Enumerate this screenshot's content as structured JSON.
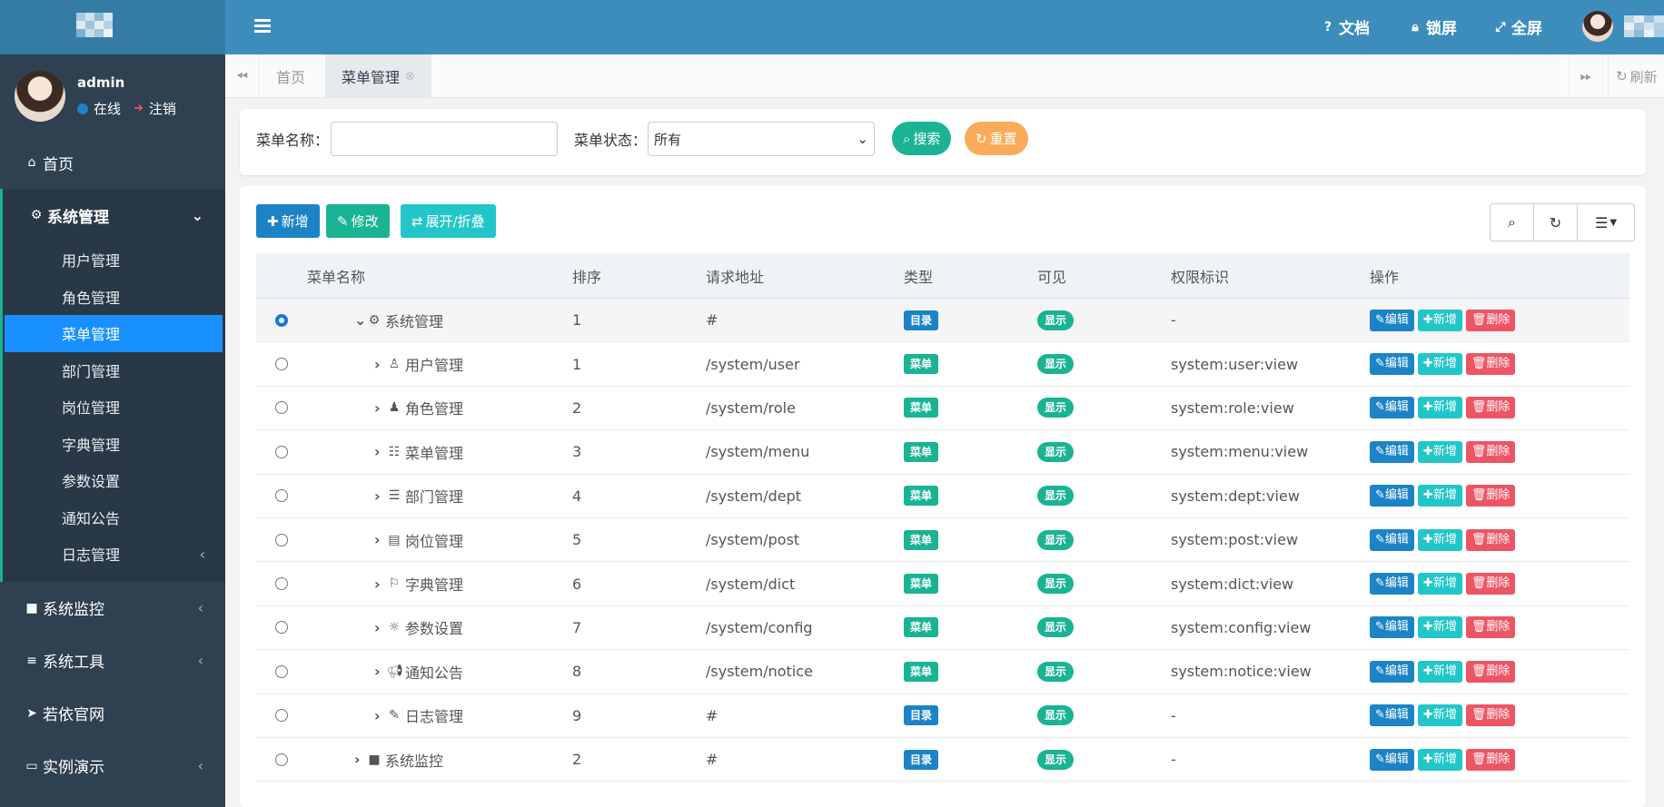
{
  "colors": {
    "sidebar": "#2f4050",
    "topbar": "#3c8dbc",
    "active": "#1890ff",
    "primary": "#1c84c6",
    "info": "#23c6c8",
    "success": "#1ab394",
    "warning": "#f8ac59",
    "danger": "#ed5565"
  },
  "user": {
    "name": "admin",
    "status": "在线",
    "logout": "注销"
  },
  "nav": {
    "home": "首页",
    "system": "系统管理",
    "system_items": [
      "用户管理",
      "角色管理",
      "菜单管理",
      "部门管理",
      "岗位管理",
      "字典管理",
      "参数设置",
      "通知公告",
      "日志管理"
    ],
    "monitor": "系统监控",
    "tools": "系统工具",
    "site": "若依官网",
    "demo": "实例演示"
  },
  "topbar": {
    "docs": "文档",
    "lock": "锁屏",
    "fullscreen": "全屏"
  },
  "tabs": {
    "home": "首页",
    "menu": "菜单管理",
    "refresh": "刷新"
  },
  "search": {
    "name_label": "菜单名称：",
    "name_value": "",
    "status_label": "菜单状态：",
    "status_value": "所有",
    "search_btn": "搜索",
    "reset_btn": "重置"
  },
  "toolbar": {
    "add": "新增",
    "edit": "修改",
    "toggle": "展开/折叠"
  },
  "table": {
    "headers": [
      "菜单名称",
      "排序",
      "请求地址",
      "类型",
      "可见",
      "权限标识",
      "操作"
    ],
    "actions": {
      "edit": "编辑",
      "add": "新增",
      "delete": "删除"
    },
    "rows": [
      {
        "name": "系统管理",
        "icon": "gear-icon",
        "order": "1",
        "url": "#",
        "type": "目录",
        "visible": "显示",
        "perm": "-",
        "level": 0,
        "selected": true
      },
      {
        "name": "用户管理",
        "icon": "user-icon",
        "order": "1",
        "url": "/system/user",
        "type": "菜单",
        "visible": "显示",
        "perm": "system:user:view",
        "level": 1
      },
      {
        "name": "角色管理",
        "icon": "user-secret-icon",
        "order": "2",
        "url": "/system/role",
        "type": "菜单",
        "visible": "显示",
        "perm": "system:role:view",
        "level": 1
      },
      {
        "name": "菜单管理",
        "icon": "list-icon",
        "order": "3",
        "url": "/system/menu",
        "type": "菜单",
        "visible": "显示",
        "perm": "system:menu:view",
        "level": 1
      },
      {
        "name": "部门管理",
        "icon": "outdent-icon",
        "order": "4",
        "url": "/system/dept",
        "type": "菜单",
        "visible": "显示",
        "perm": "system:dept:view",
        "level": 1
      },
      {
        "name": "岗位管理",
        "icon": "id-card-icon",
        "order": "5",
        "url": "/system/post",
        "type": "菜单",
        "visible": "显示",
        "perm": "system:post:view",
        "level": 1
      },
      {
        "name": "字典管理",
        "icon": "bookmark-icon",
        "order": "6",
        "url": "/system/dict",
        "type": "菜单",
        "visible": "显示",
        "perm": "system:dict:view",
        "level": 1
      },
      {
        "name": "参数设置",
        "icon": "sun-icon",
        "order": "7",
        "url": "/system/config",
        "type": "菜单",
        "visible": "显示",
        "perm": "system:config:view",
        "level": 1
      },
      {
        "name": "通知公告",
        "icon": "bullhorn-icon",
        "order": "8",
        "url": "/system/notice",
        "type": "菜单",
        "visible": "显示",
        "perm": "system:notice:view",
        "level": 1
      },
      {
        "name": "日志管理",
        "icon": "edit-icon",
        "order": "9",
        "url": "#",
        "type": "目录",
        "visible": "显示",
        "perm": "-",
        "level": 1
      },
      {
        "name": "系统监控",
        "icon": "video-icon",
        "order": "2",
        "url": "#",
        "type": "目录",
        "visible": "显示",
        "perm": "-",
        "level": 0
      }
    ]
  }
}
